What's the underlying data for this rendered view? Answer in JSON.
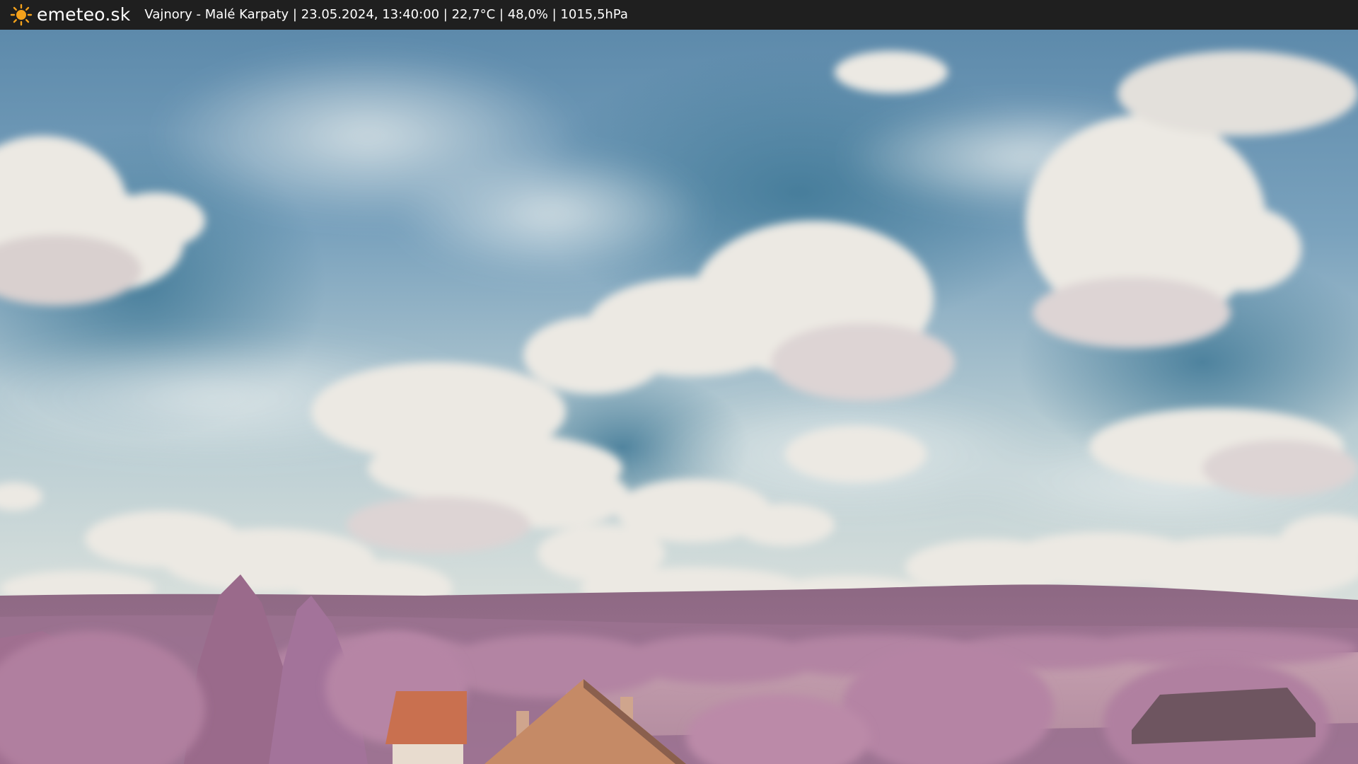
{
  "header": {
    "brand": "emeteo.sk",
    "caption": "Vajnory - Malé Karpaty | 23.05.2024, 13:40:00 | 22,7°C | 48,0% | 1015,5hPa",
    "logo_icon": "sun-icon"
  },
  "colors": {
    "bar": "#1f1f1f",
    "sun": "#f5a21b",
    "sky_top": "#5e8fb0",
    "sky_low": "#c9d7da",
    "hills": "#9a6f8e",
    "trees": "#b882a6",
    "roof": "#c9704f"
  }
}
